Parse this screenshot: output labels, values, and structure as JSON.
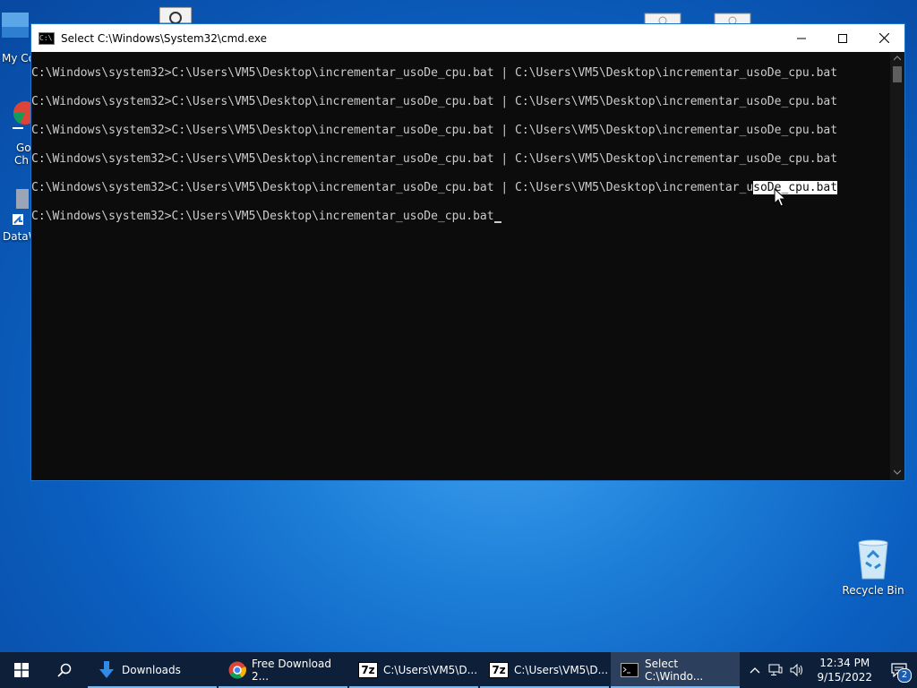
{
  "desktop": {
    "icons": [
      {
        "label": "My Co"
      },
      {
        "label": "Go"
      },
      {
        "label": "Ch"
      },
      {
        "label": "DataW"
      },
      {
        "label": "Recycle Bin"
      }
    ]
  },
  "window": {
    "title": "Select C:\\Windows\\System32\\cmd.exe",
    "lines": [
      "C:\\Windows\\system32>C:\\Users\\VM5\\Desktop\\incrementar_usoDe_cpu.bat | C:\\Users\\VM5\\Desktop\\incrementar_usoDe_cpu.bat",
      "C:\\Windows\\system32>C:\\Users\\VM5\\Desktop\\incrementar_usoDe_cpu.bat | C:\\Users\\VM5\\Desktop\\incrementar_usoDe_cpu.bat",
      "C:\\Windows\\system32>C:\\Users\\VM5\\Desktop\\incrementar_usoDe_cpu.bat | C:\\Users\\VM5\\Desktop\\incrementar_usoDe_cpu.bat",
      "C:\\Windows\\system32>C:\\Users\\VM5\\Desktop\\incrementar_usoDe_cpu.bat | C:\\Users\\VM5\\Desktop\\incrementar_usoDe_cpu.bat"
    ],
    "selected_line": {
      "before": "C:\\Windows\\system32>C:\\Users\\VM5\\Desktop\\incrementar_usoDe_cpu.bat | C:\\Users\\VM5\\Desktop\\incrementar_u",
      "selected": "soDe_cpu.bat"
    },
    "prompt_line": "C:\\Windows\\system32>C:\\Users\\VM5\\Desktop\\incrementar_usoDe_cpu.bat"
  },
  "taskbar": {
    "items": [
      {
        "label": "Downloads",
        "icon": "download-arrow-icon"
      },
      {
        "label": "Free Download 2...",
        "icon": "chrome-icon"
      },
      {
        "label": "C:\\Users\\VM5\\D...",
        "icon": "7zip-icon"
      },
      {
        "label": "C:\\Users\\VM5\\D...",
        "icon": "7zip-icon"
      },
      {
        "label": "Select C:\\Windo...",
        "icon": "cmd-icon"
      }
    ],
    "clock_time": "12:34 PM",
    "clock_date": "9/15/2022",
    "notification_count": "2",
    "seven_zip_label": "7z"
  },
  "colors": {
    "console_bg": "#0c0c0c",
    "console_fg": "#cccccc",
    "taskbar_bg": "#0e1f3a",
    "accent": "#7db6ec"
  }
}
